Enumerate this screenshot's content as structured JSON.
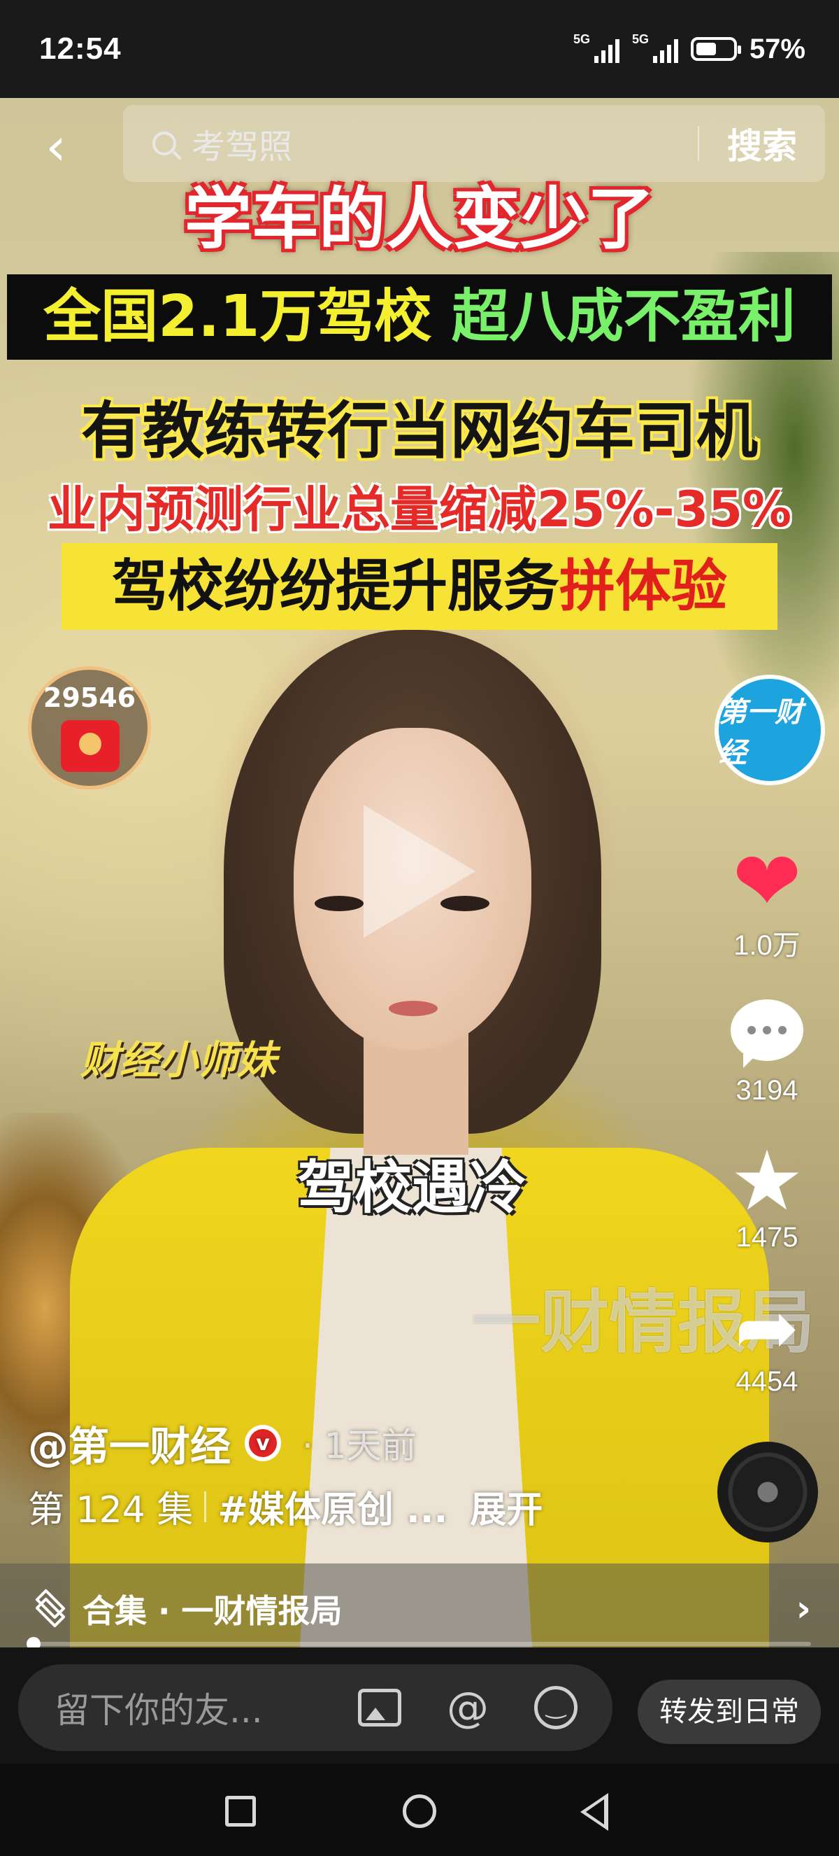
{
  "status_bar": {
    "time": "12:54",
    "signal1_label": "5G",
    "signal2_label": "5G",
    "battery_percent": "57%",
    "battery_level": 0.57
  },
  "search": {
    "placeholder": "考驾照",
    "button_label": "搜索"
  },
  "headlines": {
    "line1": "学车的人变少了",
    "line2_part1": "全国2.1万驾校",
    "line2_part2": "超八成不盈利",
    "line3": "有教练转行当网约车司机",
    "line4": "业内预测行业总量缩减25%-35%",
    "line5_part1": "驾校纷纷提升服务",
    "line5_part2": "拼体验"
  },
  "red_packet": {
    "count": "29546"
  },
  "overlays": {
    "presenter_tag": "财经小师妹",
    "subtitle": "驾校遇冷",
    "watermark": "一财情报局"
  },
  "sidebar": {
    "avatar_text": "第一财经",
    "likes": "1.0万",
    "comments": "3194",
    "favorites": "1475",
    "shares": "4454"
  },
  "video_info": {
    "author": "@第一财经",
    "verified_badge": "v",
    "posted": "· 1天前",
    "episode": "第 124 集",
    "hashtag": "#媒体原创 ...",
    "expand": "展开"
  },
  "collection": {
    "label": "合集 · 一财情报局",
    "progress": 0.0
  },
  "comment_bar": {
    "placeholder": "留下你的友...",
    "at_symbol": "@",
    "forward_label": "转发到日常"
  },
  "colors": {
    "accent_red": "#fe2c55",
    "headline_yellow": "#f7e236",
    "avatar_blue": "#1da3dd"
  }
}
